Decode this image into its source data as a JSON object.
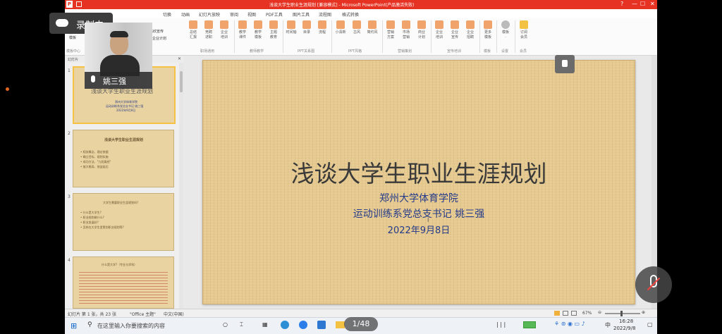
{
  "window": {
    "title": "浅谈大学生职业生涯规划 [兼容模式] - Microsoft PowerPoint(产品激活失败)"
  },
  "menu": [
    "切换",
    "动画",
    "幻灯片放映",
    "审阅",
    "视图",
    "PDF工具",
    "图片工具",
    "流程图",
    "格式转换"
  ],
  "ribbon": {
    "partial_top": "态欣宣传",
    "partial_bottom": "企业计划",
    "left_btn": "新\n模板",
    "left_group": "模板中心",
    "buttons": [
      "总结\n汇报",
      "竞聘\n述职",
      "企业\n培训",
      "教学\n课件",
      "教学\n模板",
      "主题\n教育",
      "时间轴",
      "目录",
      "流程",
      "小清新",
      "古风",
      "简约风",
      "营销\n方案",
      "市场\n营销",
      "商业\n计划",
      "企业\n培训",
      "企业\n宣传",
      "企业\n招聘",
      "更多\n模板",
      "模板\n·",
      "订阅\n会员"
    ],
    "groups": [
      "职场通用",
      "教师教学",
      "PPT关系图",
      "PPT风格",
      "营销策划",
      "宣传培训",
      "模板",
      "设置",
      "会员"
    ]
  },
  "pane": {
    "header": "幻灯片",
    "thumbnails": [
      {
        "num": "1",
        "lines": [
          "浅谈大学生职业生涯规划",
          "郑州大学体育学院",
          "运动训练系党总支书记 姚三强",
          "2022年9月8日"
        ]
      },
      {
        "num": "2",
        "lines": [
          "浅谈大学生职业生涯规划",
          "• 相关概念、理论依据",
          "• 确立目标、规划实施",
          "• 成功方法、\"九阳真经\"",
          "• 放大格局、效益延后"
        ]
      },
      {
        "num": "3",
        "lines": [
          "大学生需要职业生涯规划吗?",
          "• 什么是大学生?",
          "• 职业规划做什么?",
          "• 职业发展好?",
          "• 怎样在大学生里策划职业规划等?"
        ]
      },
      {
        "num": "4",
        "lines": [
          "什么是大学?（专业与学科）"
        ]
      }
    ]
  },
  "slide": {
    "title": "浅谈大学生职业生涯规划",
    "school": "郑州大学体育学院",
    "author": "运动训练系党总支书记 姚三强",
    "date": "2022年9月8日"
  },
  "status": {
    "slide_info": "幻灯片 第 1 张，共 23 张",
    "theme": "\"Office 主题\"",
    "lang": "中文(中国)",
    "zoom": "67%"
  },
  "taskbar": {
    "search_placeholder": "在这里输入你要搜索的内容",
    "ime": "中",
    "time": "16:28",
    "date": "2022/9/8"
  },
  "overlay": {
    "recording": "录制中",
    "presenter": "姚三强",
    "page": "1/48"
  },
  "colors": {
    "title_bar": "#e63222",
    "slide_bg": "#e5c98f",
    "slide_title": "#3a3a3a",
    "slide_sub": "#243a8a",
    "accent_orange": "#f0a36b"
  }
}
